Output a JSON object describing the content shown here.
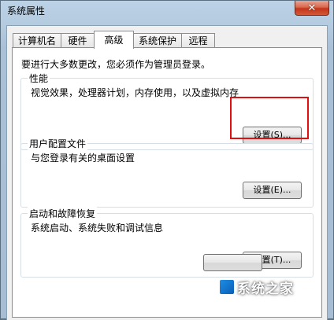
{
  "window": {
    "title": "系统属性",
    "close_symbol": "✕"
  },
  "tabs": [
    {
      "label": "计算机名",
      "active": false
    },
    {
      "label": "硬件",
      "active": false
    },
    {
      "label": "高级",
      "active": true
    },
    {
      "label": "系统保护",
      "active": false
    },
    {
      "label": "远程",
      "active": false
    }
  ],
  "panel": {
    "notice": "要进行大多数更改，您必须作为管理员登录。",
    "groups": [
      {
        "title": "性能",
        "description": "视觉效果，处理器计划，内存使用，以及虚拟内存",
        "button_label": "设置(S)..."
      },
      {
        "title": "用户配置文件",
        "description": "与您登录有关的桌面设置",
        "button_label": "设置(E)..."
      },
      {
        "title": "启动和故障恢复",
        "description": "系统启动、系统失败和调试信息",
        "button_label": "设置(T)..."
      }
    ]
  },
  "watermark": {
    "text": "系统之家",
    "logo_icon": "system-home-logo-icon"
  },
  "colors": {
    "highlight_border": "#e01010",
    "close_button": "#c4351b"
  }
}
